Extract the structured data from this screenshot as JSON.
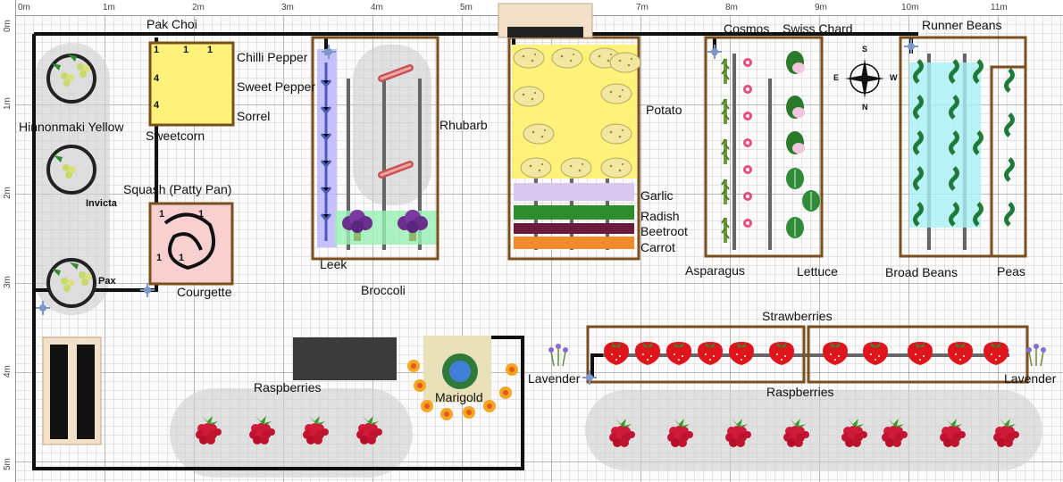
{
  "rulers": {
    "x": [
      "0m",
      "1m",
      "2m",
      "3m",
      "4m",
      "5m",
      "6m",
      "7m",
      "8m",
      "9m",
      "10m",
      "11m"
    ],
    "y": [
      "0m",
      "1m",
      "2m",
      "3m",
      "4m",
      "5m"
    ]
  },
  "beds": {
    "pak_choi": "Pak Choi",
    "chilli_pepper": "Chilli Pepper",
    "sweet_pepper": "Sweet Pepper",
    "sorrel": "Sorrel",
    "sweetcorn": "Sweetcorn",
    "hinnonmaki_yellow": "Hinnonmaki Yellow",
    "invicta": "Invicta",
    "pax": "Pax",
    "squash": "Squash (Patty Pan)",
    "courgette": "Courgette",
    "leek": "Leek",
    "broccoli": "Broccoli",
    "rhubarb": "Rhubarb",
    "potato": "Potato",
    "garlic": "Garlic",
    "radish": "Radish",
    "beetroot": "Beetroot",
    "carrot": "Carrot",
    "cosmos": "Cosmos",
    "swiss_chard": "Swiss Chard",
    "asparagus": "Asparagus",
    "lettuce": "Lettuce",
    "runner_beans": "Runner Beans",
    "broad_beans": "Broad Beans",
    "peas": "Peas",
    "strawberries": "Strawberries",
    "raspberries_right": "Raspberries",
    "raspberries_left": "Raspberries",
    "lavender_left": "Lavender",
    "lavender_right": "Lavender",
    "marigold": "Marigold"
  },
  "plant_counts": {
    "pak_choi_a": "1",
    "pak_choi_b": "1",
    "pak_choi_c": "1",
    "corn_row_a": "4",
    "corn_row_b": "4",
    "squash_a": "1",
    "squash_b": "1",
    "squash_c": "1",
    "squash_d": "1"
  },
  "compass": {
    "n": "N",
    "s": "S",
    "e": "E",
    "w": "W"
  },
  "colors": {
    "bed_border": "#7a4f1e",
    "hose": "#111111",
    "potato_zone": "#fff27a",
    "sweetcorn_zone": "#fff27a",
    "path": "#cccccc",
    "leek_zone": "#b9b4ff",
    "broccoli_zone": "#9af0b4",
    "runner_zone": "#a9f0f6"
  },
  "icons": [
    "compass-icon",
    "tap-icon",
    "raspberry-icon",
    "strawberry-icon",
    "potato-icon",
    "leek-icon",
    "broccoli-icon",
    "rhubarb-icon",
    "asparagus-icon",
    "lettuce-icon",
    "bean-icon",
    "pea-icon",
    "lavender-icon",
    "marigold-icon",
    "water-butt-icon"
  ]
}
